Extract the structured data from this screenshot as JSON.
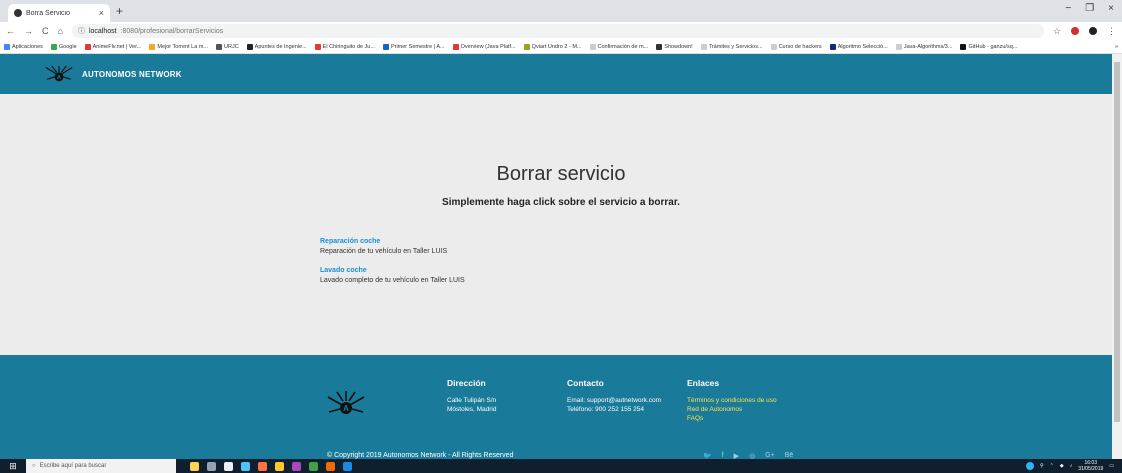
{
  "browser": {
    "tab_title": "Borra Servicio",
    "tab_close": "×",
    "new_tab": "+",
    "window_controls": [
      "−",
      "❐",
      "×"
    ],
    "nav": {
      "back": "←",
      "forward": "→",
      "reload": "C",
      "home": "⌂"
    },
    "url_host": "localhost",
    "url_path": ":8080/profesional/borrarServicios",
    "bookmarks": [
      "Aplicaciones",
      "Google",
      "AnimeFlv.net | Ver...",
      "Mejor Torrent La m...",
      "URJC",
      "Apuntes de Ingenie...",
      "El Chiringuito de Ju...",
      "Primer Semestre | A...",
      "Overview (Java Platf...",
      "Qviart Undro 2 - M...",
      "Confirmación de m...",
      "Showdown!",
      "Trámites y Servicios...",
      "Curso de hackers",
      "Algoritmo Selecció...",
      "Java-Algorithms/3...",
      "GitHub - ganzu/sq..."
    ],
    "bookmarks_more": "»"
  },
  "header": {
    "brand": "AUTONOMOS NETWORK"
  },
  "main": {
    "title": "Borrar servicio",
    "subtitle": "Simplemente haga click sobre el servicio a borrar.",
    "services": [
      {
        "name": "Reparación coche",
        "desc": "Reparación de tu vehículo en Taller LUIS"
      },
      {
        "name": "Lavado coche",
        "desc": "Lavado completo de tu vehículo en Taller LUIS"
      }
    ]
  },
  "footer": {
    "address_title": "Dirección",
    "address_line1": "Calle Tulipán S/n",
    "address_line2": "Móstoles, Madrid",
    "contact_title": "Contacto",
    "contact_email": "Email: support@autnetwork.com",
    "contact_phone": "Teléfono: 900 252 155 254",
    "links_title": "Enlaces",
    "link_terms": "Términos y condiciones de uso",
    "link_network": "Red de Autonomos",
    "link_faqs": "FAQs",
    "copyright": "© Copyright 2019 Autonomos Network - All Rights Reserved",
    "social": [
      "twitter-icon",
      "facebook-icon",
      "youtube-icon",
      "instagram-icon",
      "googleplus-icon",
      "behance-icon"
    ]
  },
  "taskbar": {
    "search_placeholder": "Escribe aquí para buscar",
    "time": "16:03",
    "date": "31/05/2019"
  },
  "colors": {
    "header_bg": "#1a7a9a",
    "link_blue": "#1a8fd6",
    "footer_link_yellow": "#ffe14d"
  }
}
